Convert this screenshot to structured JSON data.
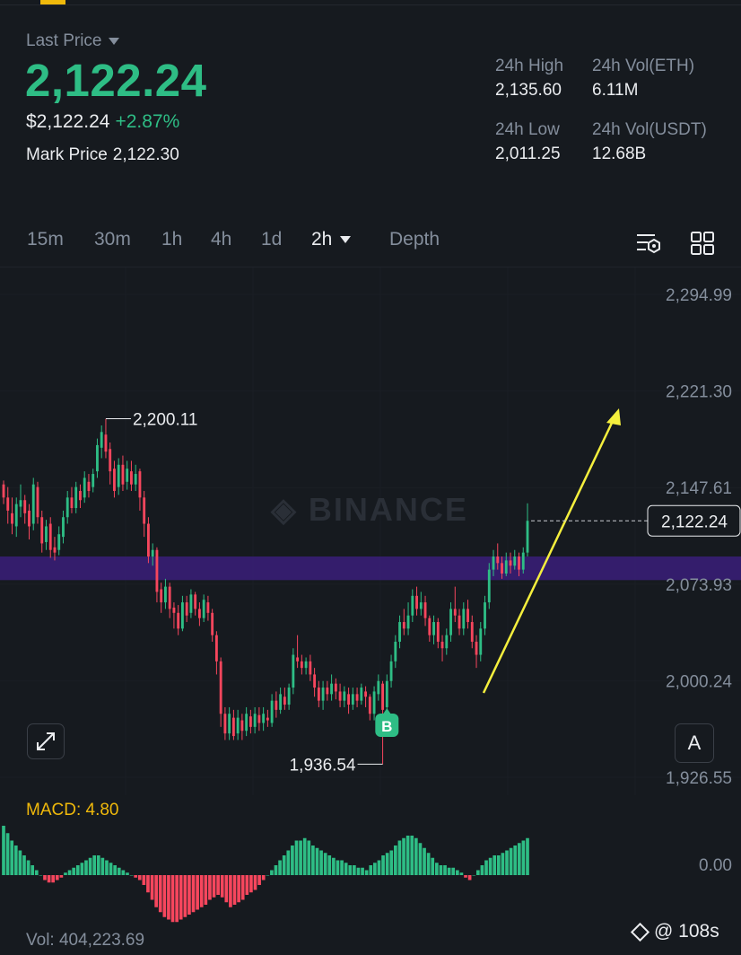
{
  "header": {
    "last_price_label": "Last Price",
    "last_price": "2,122.24",
    "usd_price": "$2,122.24",
    "change_pct": "+2.87%",
    "mark_price_label": "Mark Price",
    "mark_price": "2,122.30"
  },
  "stats": {
    "high_label": "24h High",
    "high": "2,135.60",
    "vol_eth_label": "24h Vol(ETH)",
    "vol_eth": "6.11M",
    "low_label": "24h Low",
    "low": "2,011.25",
    "vol_usdt_label": "24h Vol(USDT)",
    "vol_usdt": "12.68B"
  },
  "tabs": [
    "15m",
    "30m",
    "1h",
    "4h",
    "1d",
    "2h",
    "Depth"
  ],
  "active_tab": "2h",
  "icons": [
    "chart-settings-icon",
    "grid-icon",
    "expand-icon",
    "binance-icon"
  ],
  "colors": {
    "up": "#2ebd85",
    "down": "#f6465d",
    "accent": "#f0b90b",
    "band": "#3a1f7a",
    "arrow": "#f5ef3d"
  },
  "chart_data": {
    "type": "candlestick",
    "ylim": [
      1926.55,
      2294.99
    ],
    "y_ticks": [
      {
        "label": "2,294.99",
        "value": 2294.99
      },
      {
        "label": "2,221.30",
        "value": 2221.3
      },
      {
        "label": "2,147.61",
        "value": 2147.61
      },
      {
        "label": "2,073.93",
        "value": 2073.93
      },
      {
        "label": "2,000.24",
        "value": 2000.24
      },
      {
        "label": "1,926.55",
        "value": 1926.55
      }
    ],
    "high_marker": {
      "label": "2,200.11",
      "value": 2200.11
    },
    "low_marker": {
      "label": "1,936.54",
      "value": 1936.54
    },
    "current_price": {
      "label": "2,122.24",
      "value": 2122.24
    },
    "buy_marker": {
      "label": "B",
      "index": 90
    },
    "watermark": "BINANCE",
    "band": {
      "low": 2077,
      "high": 2095
    },
    "candles": [
      [
        2150,
        2140,
        2153,
        2135
      ],
      [
        2140,
        2130,
        2148,
        2120
      ],
      [
        2128,
        2120,
        2140,
        2112
      ],
      [
        2118,
        2135,
        2140,
        2110
      ],
      [
        2133,
        2138,
        2150,
        2125
      ],
      [
        2138,
        2128,
        2142,
        2120
      ],
      [
        2130,
        2118,
        2135,
        2108
      ],
      [
        2120,
        2150,
        2155,
        2115
      ],
      [
        2148,
        2125,
        2152,
        2120
      ],
      [
        2125,
        2105,
        2130,
        2098
      ],
      [
        2106,
        2118,
        2123,
        2100
      ],
      [
        2120,
        2100,
        2125,
        2094
      ],
      [
        2102,
        2098,
        2110,
        2092
      ],
      [
        2100,
        2112,
        2118,
        2096
      ],
      [
        2110,
        2125,
        2130,
        2105
      ],
      [
        2125,
        2140,
        2145,
        2120
      ],
      [
        2140,
        2132,
        2148,
        2128
      ],
      [
        2132,
        2148,
        2152,
        2128
      ],
      [
        2145,
        2138,
        2150,
        2132
      ],
      [
        2140,
        2155,
        2160,
        2136
      ],
      [
        2152,
        2145,
        2158,
        2140
      ],
      [
        2148,
        2158,
        2162,
        2144
      ],
      [
        2160,
        2180,
        2185,
        2155
      ],
      [
        2178,
        2190,
        2195,
        2170
      ],
      [
        2188,
        2175,
        2200,
        2170
      ],
      [
        2177,
        2160,
        2182,
        2150
      ],
      [
        2162,
        2145,
        2168,
        2140
      ],
      [
        2148,
        2165,
        2170,
        2142
      ],
      [
        2165,
        2150,
        2172,
        2145
      ],
      [
        2152,
        2162,
        2168,
        2146
      ],
      [
        2160,
        2150,
        2168,
        2145
      ],
      [
        2150,
        2158,
        2165,
        2145
      ],
      [
        2160,
        2140,
        2162,
        2130
      ],
      [
        2140,
        2120,
        2145,
        2110
      ],
      [
        2120,
        2095,
        2125,
        2090
      ],
      [
        2095,
        2100,
        2105,
        2088
      ],
      [
        2100,
        2068,
        2102,
        2060
      ],
      [
        2070,
        2060,
        2075,
        2052
      ],
      [
        2060,
        2072,
        2078,
        2055
      ],
      [
        2072,
        2055,
        2075,
        2048
      ],
      [
        2056,
        2052,
        2060,
        2040
      ],
      [
        2052,
        2040,
        2058,
        2035
      ],
      [
        2040,
        2060,
        2065,
        2038
      ],
      [
        2060,
        2050,
        2065,
        2045
      ],
      [
        2052,
        2066,
        2070,
        2048
      ],
      [
        2066,
        2055,
        2068,
        2050
      ],
      [
        2055,
        2048,
        2060,
        2042
      ],
      [
        2048,
        2062,
        2066,
        2045
      ],
      [
        2060,
        2052,
        2065,
        2046
      ],
      [
        2052,
        2035,
        2055,
        2030
      ],
      [
        2035,
        2015,
        2038,
        2005
      ],
      [
        2015,
        1975,
        2018,
        1965
      ],
      [
        1975,
        1960,
        1980,
        1955
      ],
      [
        1960,
        1975,
        1980,
        1955
      ],
      [
        1972,
        1958,
        1978,
        1955
      ],
      [
        1960,
        1972,
        1978,
        1955
      ],
      [
        1970,
        1962,
        1975,
        1955
      ],
      [
        1962,
        1975,
        1980,
        1958
      ],
      [
        1973,
        1965,
        1978,
        1960
      ],
      [
        1965,
        1975,
        1980,
        1960
      ],
      [
        1974,
        1968,
        1980,
        1962
      ],
      [
        1968,
        1975,
        1980,
        1962
      ],
      [
        1972,
        1970,
        1978,
        1965
      ],
      [
        1968,
        1985,
        1990,
        1965
      ],
      [
        1985,
        1978,
        1992,
        1972
      ],
      [
        1978,
        1990,
        1995,
        1975
      ],
      [
        1988,
        1982,
        1995,
        1978
      ],
      [
        1982,
        1995,
        1998,
        1978
      ],
      [
        1995,
        2020,
        2025,
        1990
      ],
      [
        2018,
        2015,
        2035,
        2010
      ],
      [
        2015,
        2010,
        2020,
        2005
      ],
      [
        2010,
        2015,
        2018,
        2005
      ],
      [
        2015,
        2005,
        2020,
        2000
      ],
      [
        2005,
        1995,
        2010,
        1988
      ],
      [
        1995,
        1985,
        2000,
        1980
      ],
      [
        1985,
        1995,
        2000,
        1978
      ],
      [
        1995,
        1990,
        2000,
        1985
      ],
      [
        1990,
        1998,
        2005,
        1985
      ],
      [
        1998,
        1992,
        2002,
        1986
      ],
      [
        1992,
        1985,
        1998,
        1980
      ],
      [
        1985,
        1992,
        1996,
        1980
      ],
      [
        1990,
        1982,
        1995,
        1975
      ],
      [
        1982,
        1990,
        1995,
        1978
      ],
      [
        1990,
        1985,
        1995,
        1980
      ],
      [
        1985,
        1995,
        1998,
        1982
      ],
      [
        1992,
        1988,
        1996,
        1980
      ],
      [
        1988,
        1975,
        1990,
        1970
      ],
      [
        1975,
        1992,
        1996,
        1970
      ],
      [
        1990,
        2000,
        2005,
        1985
      ],
      [
        1998,
        1978,
        2000,
        1936.54
      ],
      [
        1980,
        2000,
        2005,
        1975
      ],
      [
        2000,
        2015,
        2020,
        1995
      ],
      [
        2015,
        2030,
        2035,
        2010
      ],
      [
        2030,
        2045,
        2050,
        2025
      ],
      [
        2045,
        2040,
        2055,
        2035
      ],
      [
        2040,
        2050,
        2060,
        2035
      ],
      [
        2050,
        2065,
        2070,
        2045
      ],
      [
        2065,
        2055,
        2072,
        2050
      ],
      [
        2055,
        2060,
        2068,
        2050
      ],
      [
        2060,
        2048,
        2065,
        2042
      ],
      [
        2048,
        2035,
        2050,
        2030
      ],
      [
        2035,
        2045,
        2050,
        2028
      ],
      [
        2045,
        2030,
        2048,
        2025
      ],
      [
        2030,
        2025,
        2035,
        2015
      ],
      [
        2025,
        2035,
        2040,
        2020
      ],
      [
        2035,
        2055,
        2060,
        2030
      ],
      [
        2055,
        2050,
        2072,
        2045
      ],
      [
        2050,
        2040,
        2055,
        2035
      ],
      [
        2040,
        2055,
        2060,
        2035
      ],
      [
        2055,
        2045,
        2062,
        2040
      ],
      [
        2045,
        2030,
        2050,
        2025
      ],
      [
        2030,
        2020,
        2035,
        2010
      ],
      [
        2020,
        2040,
        2045,
        2015
      ],
      [
        2040,
        2060,
        2065,
        2035
      ],
      [
        2060,
        2085,
        2090,
        2055
      ],
      [
        2085,
        2095,
        2100,
        2080
      ],
      [
        2095,
        2090,
        2105,
        2085
      ],
      [
        2090,
        2082,
        2095,
        2078
      ],
      [
        2082,
        2092,
        2098,
        2080
      ],
      [
        2092,
        2088,
        2098,
        2082
      ],
      [
        2088,
        2095,
        2100,
        2085
      ],
      [
        2095,
        2085,
        2098,
        2080
      ],
      [
        2085,
        2098,
        2102,
        2082
      ],
      [
        2098,
        2122.24,
        2135.6,
        2095
      ]
    ],
    "macd": {
      "label": "MACD: 4.80",
      "zero_label": "0.00",
      "histogram": [
        20,
        17,
        14,
        12,
        10,
        8,
        6,
        4,
        2,
        0,
        -2,
        -3,
        -3,
        -2,
        -1,
        1,
        2,
        3,
        4,
        5,
        6,
        7,
        8,
        8,
        7,
        6,
        5,
        4,
        3,
        2,
        1,
        0,
        -1,
        -2,
        -4,
        -7,
        -10,
        -13,
        -15,
        -17,
        -18,
        -19,
        -19,
        -18,
        -17,
        -16,
        -15,
        -14,
        -13,
        -12,
        -10,
        -9,
        -8,
        -9,
        -11,
        -13,
        -12,
        -11,
        -10,
        -8,
        -7,
        -6,
        -4,
        -2,
        0,
        2,
        4,
        6,
        8,
        10,
        12,
        14,
        14,
        15,
        14,
        12,
        11,
        10,
        9,
        8,
        7,
        6,
        6,
        5,
        4,
        4,
        3,
        3,
        2,
        4,
        5,
        6,
        8,
        9,
        10,
        12,
        14,
        15,
        16,
        16,
        15,
        13,
        11,
        9,
        7,
        5,
        4,
        4,
        3,
        3,
        2,
        1,
        -1,
        -2,
        0,
        2,
        4,
        6,
        7,
        8,
        8,
        9,
        10,
        11,
        12,
        13,
        14,
        15
      ]
    },
    "volume": {
      "label": "Vol: 404,223.69"
    },
    "timer": "@ 108s"
  }
}
